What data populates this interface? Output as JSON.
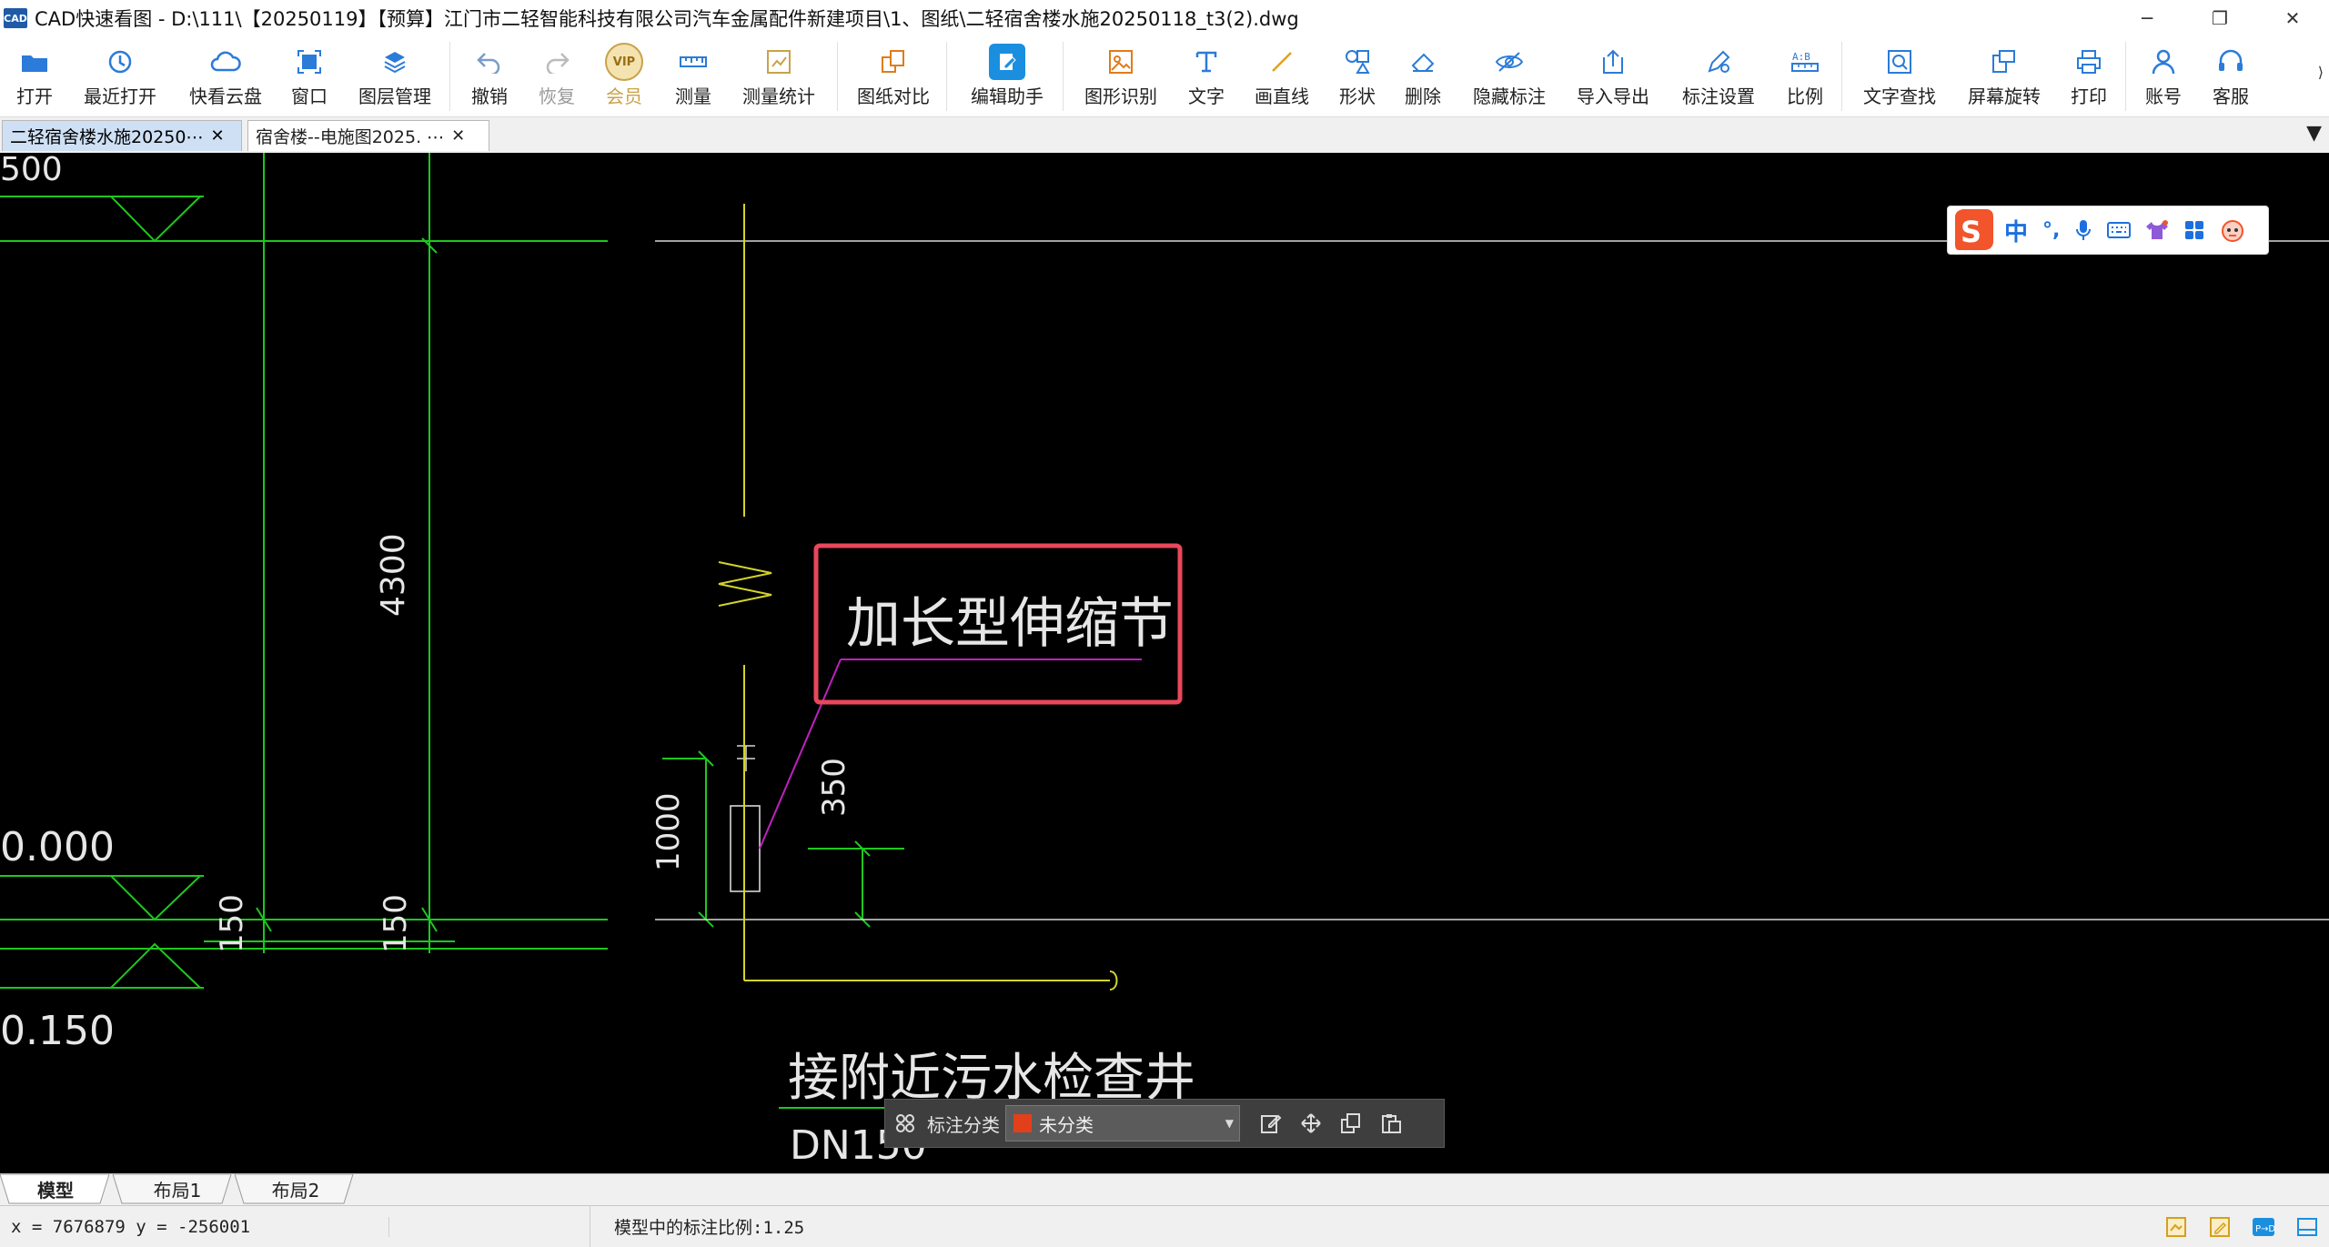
{
  "window": {
    "app_logo": "CAD",
    "title": "CAD快速看图 - D:\\111\\【20250119】【预算】江门市二轻智能科技有限公司汽车金属配件新建项目\\1、图纸\\二轻宿舍楼水施20250118_t3(2).dwg"
  },
  "toolbar": {
    "open": "打开",
    "recent": "最近打开",
    "cloud": "快看云盘",
    "window": "窗口",
    "layers": "图层管理",
    "undo": "撤销",
    "redo": "恢复",
    "vip_badge": "VIP",
    "vip": "会员",
    "measure": "测量",
    "measure_stats": "测量统计",
    "compare": "图纸对比",
    "edit_assistant": "编辑助手",
    "shape_recog": "图形识别",
    "text": "文字",
    "line": "画直线",
    "shape": "形状",
    "delete": "删除",
    "hide_annot": "隐藏标注",
    "import_export": "导入导出",
    "annot_settings": "标注设置",
    "ratio": "比例",
    "text_search": "文字查找",
    "rotate_screen": "屏幕旋转",
    "print": "打印",
    "account": "账号",
    "support": "客服"
  },
  "tabs": [
    {
      "label": "二轻宿舍楼水施20250⋯",
      "active": true
    },
    {
      "label": "宿舍楼--电施图2025. ⋯",
      "active": false
    }
  ],
  "drawing": {
    "dim_top_left": "500",
    "dim_4300": "4300",
    "level_zero": "0.000",
    "dim_150_a": "150",
    "dim_150_b": "150",
    "level_neg": "0.150",
    "dim_1000": "1000",
    "dim_350": "350",
    "callout": "加长型伸缩节",
    "note": "接附近污水检查井",
    "pipe": "DN150"
  },
  "ime": {
    "cn": "中",
    "punct": "°,"
  },
  "floatbar": {
    "category_label": "标注分类",
    "category_value": "未分类"
  },
  "layouts": [
    {
      "label": "模型",
      "active": true
    },
    {
      "label": "布局1",
      "active": false
    },
    {
      "label": "布局2",
      "active": false
    }
  ],
  "status": {
    "coords": "x = 7676879  y = -256001",
    "scale": "模型中的标注比例:1.25"
  },
  "colors": {
    "canvas_bg": "#000000",
    "dim_green": "#1ec81e",
    "wall_yellow": "#d4d42a",
    "leader_magenta": "#c020c0",
    "highlight_red": "#e8485a",
    "drawing_white": "#e6e6e6",
    "toolbar_icon_blue": "#2b7bd8"
  }
}
